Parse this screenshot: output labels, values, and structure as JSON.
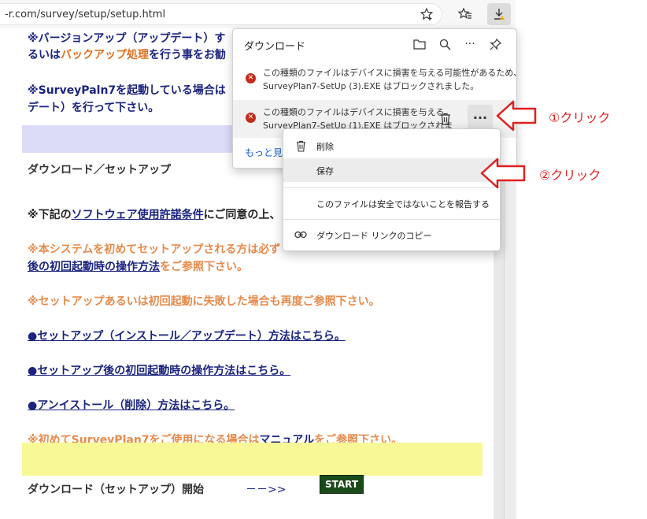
{
  "browser": {
    "address": "-r.com/survey/setup/setup.html",
    "icons": [
      "star-add-icon",
      "favorites-icon",
      "download-icon"
    ]
  },
  "page": {
    "line1a": "※バージョンアップ（アップデート）す",
    "line1b_pre": "るいは",
    "line1b_orange": "バックアップ処理",
    "line1b_post": "を行う事をお勧",
    "line2a": "※SurveyPaln7を起動している場合は",
    "line2b": "デート）を行って下さい。",
    "section_title": "ダウンロード／セットアップ",
    "notice_pre": "※下記の",
    "notice_link": "ソフトウェア使用許諾条件",
    "notice_post": "にご同意の上、",
    "first_setup_a": "※本システムを初めてセットアップされる方は必ず",
    "first_setup_b_link": "後の初回起動時の操作方法",
    "first_setup_b_post": "をご参照下さい。",
    "fail_notice": "※セットアップあるいは初回起動に失敗した場合も再度ご参照下さい。",
    "link_setup": "●セットアップ（インストール／アップデート）方法はこちら。",
    "link_first_run": "●セットアップ後の初回起動時の操作方法はこちら。",
    "link_uninstall": "●アンイストール（削除）方法はこちら。",
    "manual_pre": "※初めてSurveyPlan7をご使用になる場合は",
    "manual_link": "マニュアル",
    "manual_post": "をご参照下さい。",
    "start_label": "ダウンロード（セットアップ）開始",
    "start_arrow": "－－>>",
    "start_button": "START"
  },
  "downloads": {
    "title": "ダウンロード",
    "items": [
      {
        "line1": "この種類のファイルはデバイスに損害を与える可能性があるため、",
        "line2": "SurveyPlan7-SetUp (3).EXE はブロックされました。"
      },
      {
        "line1": "この種類のファイルはデバイスに損害を与える",
        "line2": "SurveyPlan7-SetUp (1).EXE はブロックされま"
      }
    ],
    "more": "もっと見る"
  },
  "context_menu": {
    "delete": "削除",
    "keep": "保存",
    "report": "このファイルは安全ではないことを報告する",
    "copy_link": "ダウンロード リンクのコピー"
  },
  "annotations": {
    "click1": "①クリック",
    "click2": "②クリック",
    "color": "#e02020"
  }
}
